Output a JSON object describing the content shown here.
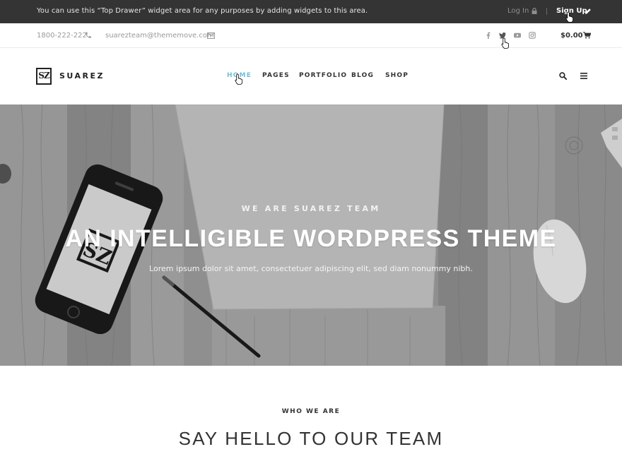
{
  "top_drawer": {
    "message": "You can use this “Top Drawer” widget area for any purposes by adding widgets to this area.",
    "login_label": "Log In",
    "signup_label": "Sign Up"
  },
  "contact_bar": {
    "phone": "1800-222-222",
    "email": "suarezteam@thememove.com",
    "social_icons": [
      "facebook-icon",
      "twitter-icon",
      "youtube-icon",
      "instagram-icon"
    ],
    "cart_total": "$0.00"
  },
  "header": {
    "logo_mark": "SZ",
    "logo_text": "SUAREZ",
    "nav": [
      {
        "label": "HOME",
        "active": true
      },
      {
        "label": "PAGES",
        "active": false
      },
      {
        "label": "PORTFOLIO",
        "active": false
      },
      {
        "label": "BLOG",
        "active": false
      },
      {
        "label": "SHOP",
        "active": false
      }
    ]
  },
  "hero": {
    "subtitle": "WE ARE SUAREZ TEAM",
    "title": "AN INTELLIGIBLE WORDPRESS THEME",
    "description": "Lorem ipsum dolor sit amet, consectetuer adipiscing elit, sed diam nonummy nibh."
  },
  "section": {
    "kicker": "WHO WE ARE",
    "title": "SAY HELLO TO OUR TEAM"
  },
  "colors": {
    "accent": "#6fc1d8",
    "top_drawer_bg": "#343434",
    "text_dark": "#333333",
    "text_muted": "#9a9a9a"
  }
}
